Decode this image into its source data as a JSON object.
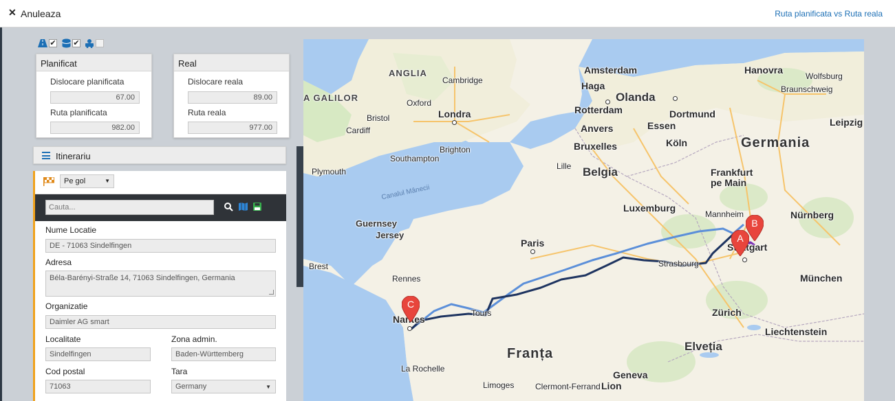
{
  "header": {
    "close_icon": "close-icon",
    "title": "Anuleaza",
    "link": "Ruta planificata vs Ruta reala"
  },
  "toggles": [
    {
      "icon": "road-icon",
      "checked": true
    },
    {
      "icon": "stack-icon",
      "checked": true
    },
    {
      "icon": "vehicle-icon",
      "checked": false
    }
  ],
  "planned": {
    "title": "Planificat",
    "displacement_label": "Dislocare planificata",
    "displacement_value": "67.00",
    "route_label": "Ruta planificata",
    "route_value": "982.00"
  },
  "real": {
    "title": "Real",
    "displacement_label": "Dislocare reala",
    "displacement_value": "89.00",
    "route_label": "Ruta reala",
    "route_value": "977.00"
  },
  "itinerary": {
    "title": "Itinerariu"
  },
  "stop": {
    "type_selected": "Pe gol",
    "search_placeholder": "Cauta...",
    "location_name_label": "Nume Locatie",
    "location_name_value": "DE - 71063 Sindelfingen",
    "address_label": "Adresa",
    "address_value": "Béla-Barényi-Straße 14, 71063 Sindelfingen, Germania",
    "organization_label": "Organizatie",
    "organization_value": "Daimler AG smart",
    "city_label": "Localitate",
    "city_value": "Sindelfingen",
    "zone_label": "Zona admin.",
    "zone_value": "Baden-Württemberg",
    "postal_label": "Cod postal",
    "postal_value": "71063",
    "country_label": "Tara",
    "country_value": "Germany"
  },
  "map": {
    "labels": {
      "anglia": "ANGLIA",
      "galilor": "A GALILOR",
      "cambridge": "Cambridge",
      "oxford": "Oxford",
      "londra": "Londra",
      "bristol": "Bristol",
      "cardiff": "Cardiff",
      "brighton": "Brighton",
      "southampton": "Southampton",
      "plymouth": "Plymouth",
      "canal": "Canalul Mânecii",
      "guernsey": "Guernsey",
      "jersey": "Jersey",
      "amsterdam": "Amsterdam",
      "haga": "Haga",
      "olanda": "Olanda",
      "rotterdam": "Rotterdam",
      "anvers": "Anvers",
      "bruxelles": "Bruxelles",
      "lille": "Lille",
      "belgia": "Belgia",
      "luxemburg": "Luxemburg",
      "hanovra": "Hanovra",
      "wolfsburg": "Wolfsburg",
      "braunschweig": "Braunschweig",
      "dortmund": "Dortmund",
      "essen": "Essen",
      "leipzig": "Leipzig",
      "germania": "Germania",
      "koln": "Köln",
      "frankfurt": "Frankfurt\npe Main",
      "mannheim": "Mannheim",
      "nurnberg": "Nürnberg",
      "stuttgart": "Stuttgart",
      "strasbourg": "Strasbourg",
      "munchen": "München",
      "paris": "Paris",
      "brest": "Brest",
      "rennes": "Rennes",
      "nantes": "Nantes",
      "tours": "Tours",
      "franta": "Franța",
      "zurich": "Zürich",
      "liechtenstein": "Liechtenstein",
      "elvetia": "Elveția",
      "la_rochelle": "La Rochelle",
      "limoges": "Limoges",
      "clermont": "Clermont-Ferrand",
      "geneva": "Geneva",
      "lion": "Lion"
    },
    "markers": [
      {
        "letter": "A",
        "color": "#e8453c"
      },
      {
        "letter": "B",
        "color": "#e8453c"
      },
      {
        "letter": "C",
        "color": "#e8453c"
      }
    ],
    "route_colors": {
      "planned": "#5b8fd9",
      "real": "#1e3460",
      "segment": "#7a2fb5"
    }
  }
}
